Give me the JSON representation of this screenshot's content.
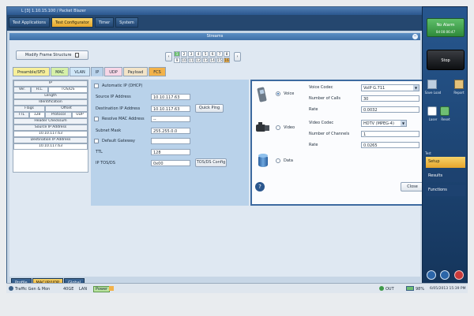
{
  "window": {
    "title": "L [3] 1.10.15.100 / Packet Blazer"
  },
  "main_tabs": [
    {
      "label": "Test Applications"
    },
    {
      "label": "Test Configurator"
    },
    {
      "label": "Timer"
    },
    {
      "label": "System"
    }
  ],
  "streams": {
    "title": "Streams",
    "modify_label": "Modify Frame Structure",
    "stream_numbers_row1": [
      "1",
      "2",
      "3",
      "4",
      "5",
      "6",
      "7",
      "8"
    ],
    "stream_numbers_row2": [
      "9",
      "10",
      "11",
      "12",
      "13",
      "14",
      "15",
      "16"
    ]
  },
  "protocol_tabs": [
    {
      "label": "Preamble/SFD"
    },
    {
      "label": "MAC"
    },
    {
      "label": "VLAN"
    },
    {
      "label": "IP"
    },
    {
      "label": "UDP"
    },
    {
      "label": "Payload"
    },
    {
      "label": "FCS"
    }
  ],
  "ip_header": {
    "title": "IP",
    "row1": [
      "Ver.",
      "H.L.",
      "TOS/DS"
    ],
    "row2": "Length",
    "row3": "Identification",
    "row4": [
      "Flags",
      "Offset"
    ],
    "row5": [
      "TTL",
      "128",
      "Protocol",
      "UDP"
    ],
    "row6": "Header Checksum",
    "row7_label": "Source IP Address",
    "row7_value": "10.10.117.63",
    "row8_label": "Destination IP Address",
    "row8_value": "10.10.117.63"
  },
  "ip_form": {
    "auto_ip_label": "Automatic IP (DHCP)",
    "source_ip_label": "Source IP Address",
    "source_ip_value": "10.10.117.63",
    "dest_ip_label": "Destination IP Address",
    "dest_ip_value": "10.10.117.63",
    "quick_ping_label": "Quick Ping",
    "resolve_mac_label": "Resolve MAC Address",
    "resolve_mac_value": "--",
    "subnet_label": "Subnet Mask",
    "subnet_value": "255.255.0.0",
    "gateway_label": "Default Gateway",
    "gateway_value": "",
    "ttl_label": "TTL",
    "ttl_value": "128",
    "tos_label": "IP TOS/DS",
    "tos_value": "0x00",
    "tos_config_label": "TOS/DS Config"
  },
  "codec_dialog": {
    "voice_label": "Voice",
    "video_label": "Video",
    "data_label": "Data",
    "voice_codec_label": "Voice Codec",
    "voice_codec_value": "VoIP G.711",
    "voice_calls_label": "Number of Calls",
    "voice_calls_value": "30",
    "voice_rate_label": "Rate",
    "voice_rate_value": "0.0032",
    "video_codec_label": "Video Codec",
    "video_codec_value": "HDTV (MPEG-4)",
    "video_channels_label": "Number of Channels",
    "video_channels_value": "1",
    "video_rate_label": "Rate",
    "video_rate_value": "0.0265",
    "close_label": "Close",
    "help_label": "?"
  },
  "bottom_tabs": [
    {
      "label": "Profile"
    },
    {
      "label": "MAC/IP/UDP"
    },
    {
      "label": "Global"
    }
  ],
  "right_panel": {
    "alarm_label": "No Alarm",
    "alarm_time": "0d 00:06:47",
    "stop_label": "Stop",
    "save_load_label": "Save Load",
    "report_label": "Report",
    "laser_label": "Laser",
    "reset_label": "Reset",
    "test_label": "Test",
    "menu": [
      {
        "label": "Setup"
      },
      {
        "label": "Results"
      },
      {
        "label": "Functions"
      }
    ]
  },
  "status_bar": {
    "app_label": "Traffic Gen & Mon",
    "mode_label": "40GE",
    "lan_label": "LAN",
    "power_label": "Power",
    "out_label": "OUT",
    "battery_label": "98%",
    "datetime_label": "6/05/2013 15:39 PM"
  },
  "colors": {
    "accent": "#e6a52c",
    "nav_blue": "#25476f",
    "alarm_green": "#3f9a4a"
  }
}
